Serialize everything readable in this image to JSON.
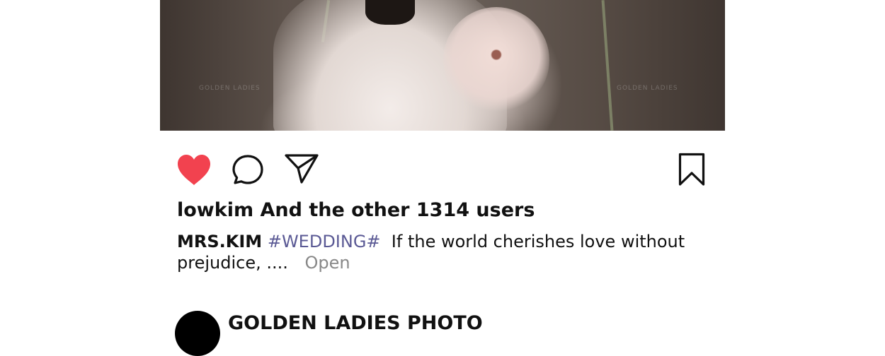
{
  "post": {
    "image_alt": "Bride in white gown with large pink flower",
    "watermarks": [
      "GOLDEN LADIES",
      "GOLDEN LADIES"
    ],
    "actions": {
      "like_icon": "heart-icon",
      "comment_icon": "comment-bubble-icon",
      "share_icon": "paper-plane-icon",
      "save_icon": "bookmark-icon",
      "like_color": "#f2424f"
    },
    "likes_text": "lowkim And the other 1314 users",
    "caption": {
      "author": "MRS.KIM",
      "hashtag": "#WEDDING#",
      "text": "If the world cherishes love without prejudice, ....",
      "more_label": "Open"
    }
  },
  "next_post": {
    "account_name": "GOLDEN LADIES PHOTO"
  }
}
